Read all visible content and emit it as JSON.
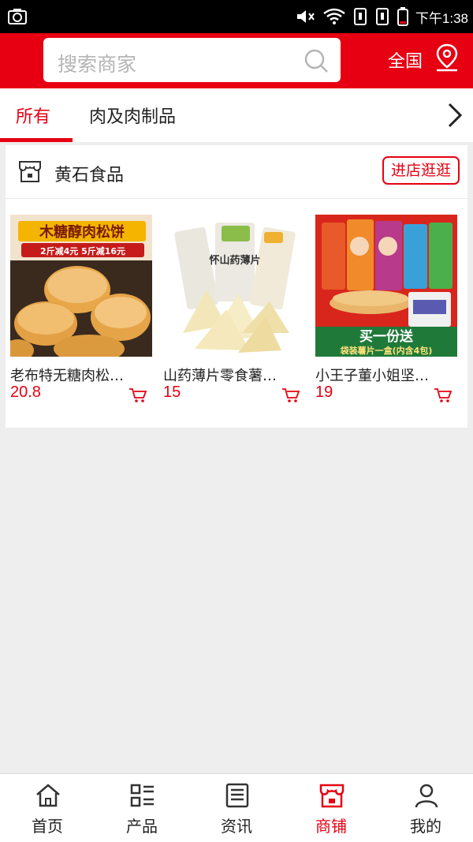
{
  "status_bar": {
    "time": "下午1:38"
  },
  "header": {
    "search_placeholder": "搜索商家",
    "region": "全国"
  },
  "tabs": [
    {
      "label": "所有",
      "active": true
    },
    {
      "label": "肉及肉制品",
      "active": false
    }
  ],
  "shop": {
    "name": "黄石食品",
    "visit_label": "进店逛逛",
    "products": [
      {
        "name": "老布特无糖肉松…",
        "price": "20.8",
        "banner": "木糖醇肉松饼",
        "promo": "2斤减4元 5斤减16元"
      },
      {
        "name": "山药薄片零食薯…",
        "price": "15",
        "bag_text": "怀山药薄片"
      },
      {
        "name": "小王子董小姐坚…",
        "price": "19",
        "promo_big": "买一份送",
        "promo_small": "袋装薯片一盒(内含4包)"
      }
    ]
  },
  "bottom_nav": [
    {
      "label": "首页",
      "icon": "home-icon"
    },
    {
      "label": "产品",
      "icon": "grid-list-icon"
    },
    {
      "label": "资讯",
      "icon": "news-icon"
    },
    {
      "label": "商铺",
      "icon": "shop-icon",
      "active": true
    },
    {
      "label": "我的",
      "icon": "user-icon"
    }
  ],
  "colors": {
    "brand": "#e60012",
    "background": "#eeeeee"
  }
}
